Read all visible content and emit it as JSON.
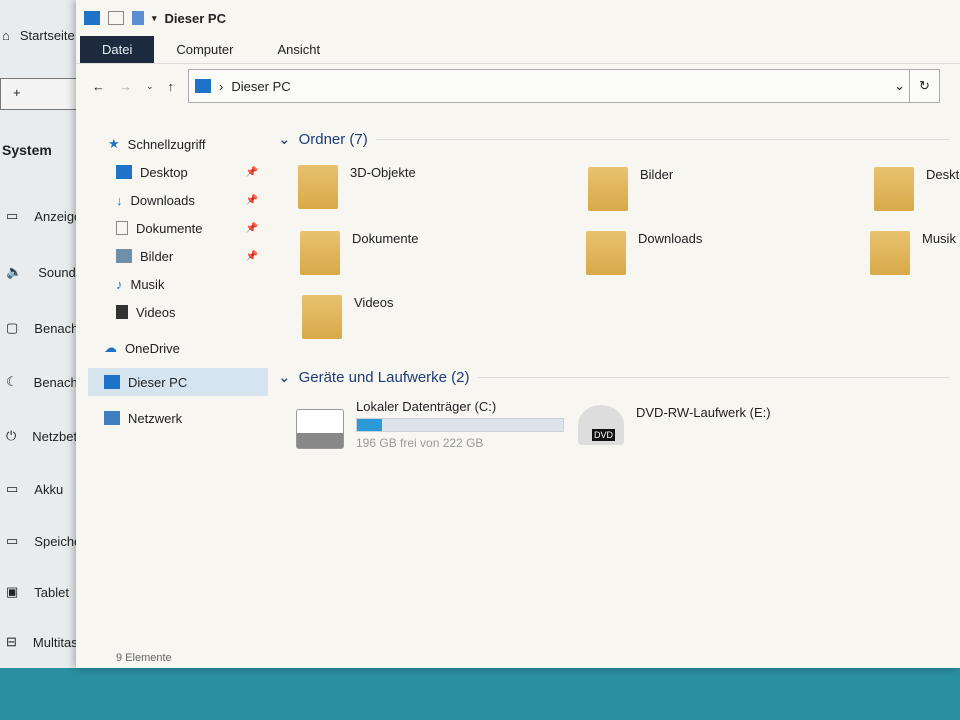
{
  "background_settings": {
    "home": "Startseite",
    "add": "+",
    "section": "System",
    "items": [
      "Anzeige",
      "Sound",
      "Benachrichtigungen",
      "Benachrichtigungsassistent",
      "Netzbetrieb",
      "Akku",
      "Speicher",
      "Tablet",
      "Multitasking"
    ]
  },
  "window": {
    "title": "Dieser PC",
    "ribbon": {
      "tabs": [
        "Datei",
        "Computer",
        "Ansicht"
      ],
      "active": "Datei"
    },
    "address": {
      "path": "Dieser PC"
    },
    "sidebar": [
      {
        "label": "Schnellzugriff",
        "icon": "star-icon"
      },
      {
        "label": "Desktop",
        "icon": "desktop-icon",
        "pinned": true
      },
      {
        "label": "Downloads",
        "icon": "download-icon",
        "pinned": true
      },
      {
        "label": "Dokumente",
        "icon": "document-icon",
        "pinned": true
      },
      {
        "label": "Bilder",
        "icon": "picture-icon",
        "pinned": true
      },
      {
        "label": "Musik",
        "icon": "music-icon"
      },
      {
        "label": "Videos",
        "icon": "video-icon"
      },
      {
        "label": "OneDrive",
        "icon": "cloud-icon"
      },
      {
        "label": "Dieser PC",
        "icon": "pc-icon",
        "selected": true
      },
      {
        "label": "Netzwerk",
        "icon": "network-icon"
      }
    ],
    "folders_header": "Ordner (7)",
    "folders": [
      "3D-Objekte",
      "Bilder",
      "Desktop",
      "Dokumente",
      "Downloads",
      "Musik",
      "Videos"
    ],
    "drives_header": "Geräte und Laufwerke (2)",
    "drives": [
      {
        "name": "Lokaler Datenträger (C:)",
        "free": "196 GB frei von 222 GB",
        "used_fraction": 0.12
      },
      {
        "name": "DVD-RW-Laufwerk (E:)"
      }
    ],
    "status": "9 Elemente"
  },
  "colors": {
    "accent": "#2a9bd8",
    "ribbon_active": "#1e2a3e"
  }
}
